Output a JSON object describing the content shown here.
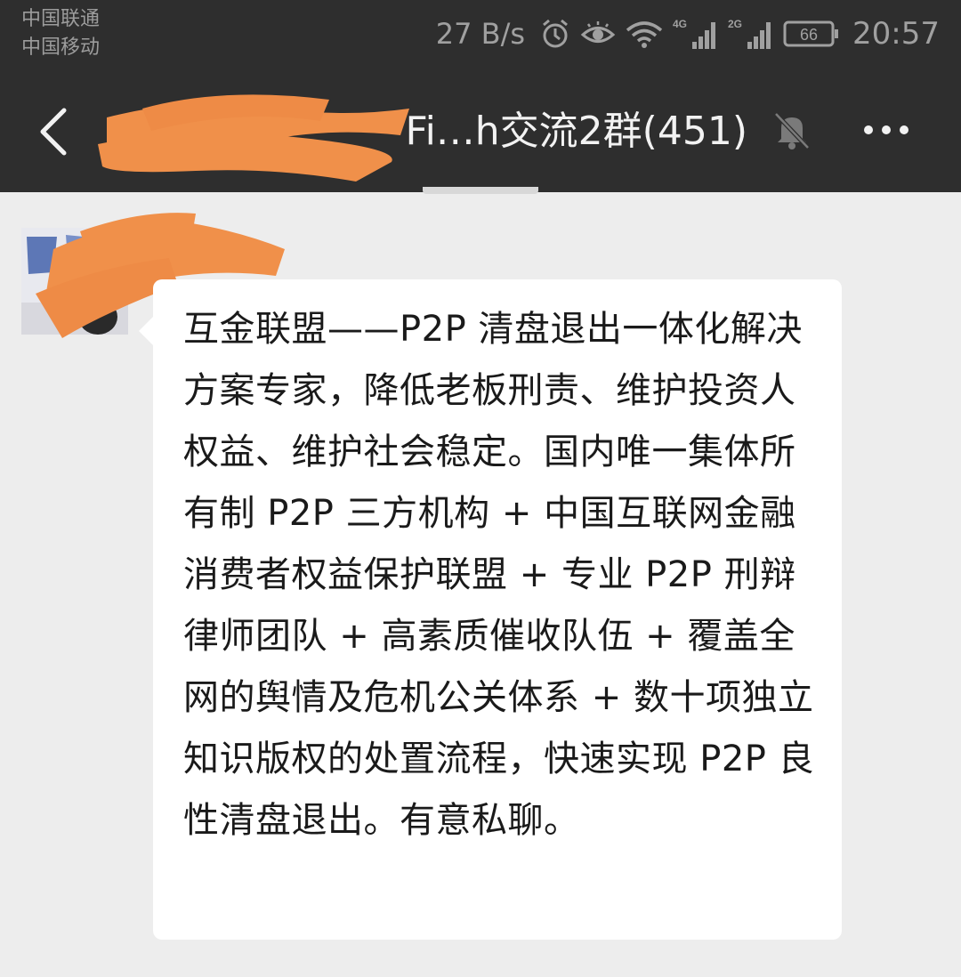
{
  "status_bar": {
    "carrier_1": "中国联通",
    "carrier_2": "中国移动",
    "network_speed": "27 B/s",
    "icons": [
      "alarm-icon",
      "eye-comfort-icon",
      "wifi-icon",
      "signal-4g-icon",
      "signal-2g-icon",
      "battery-icon"
    ],
    "signal_4g_label": "4G",
    "signal_2g_label": "2G",
    "battery_level": "66",
    "time": "20:57"
  },
  "header": {
    "title": "Fi…h交流2群(451)",
    "back_icon": "chevron-left-icon",
    "mute_icon": "bell-muted-icon",
    "more_icon": "more-dots-icon"
  },
  "message": {
    "text": "互金联盟——P2P 清盘退出一体化解决方案专家，降低老板刑责、维护投资人权益、维护社会稳定。国内唯一集体所有制 P2P 三方机构 + 中国互联网金融消费者权益保护联盟 + 专业 P2P 刑辩律师团队 + 高素质催收队伍 + 覆盖全网的舆情及危机公关体系 + 数十项独立知识版权的处置流程，快速实现 P2P 良性清盘退出。有意私聊。"
  },
  "colors": {
    "header_bg": "#2e2e2e",
    "chat_bg": "#ededed",
    "bubble_bg": "#ffffff",
    "redaction": "#f0904a"
  }
}
